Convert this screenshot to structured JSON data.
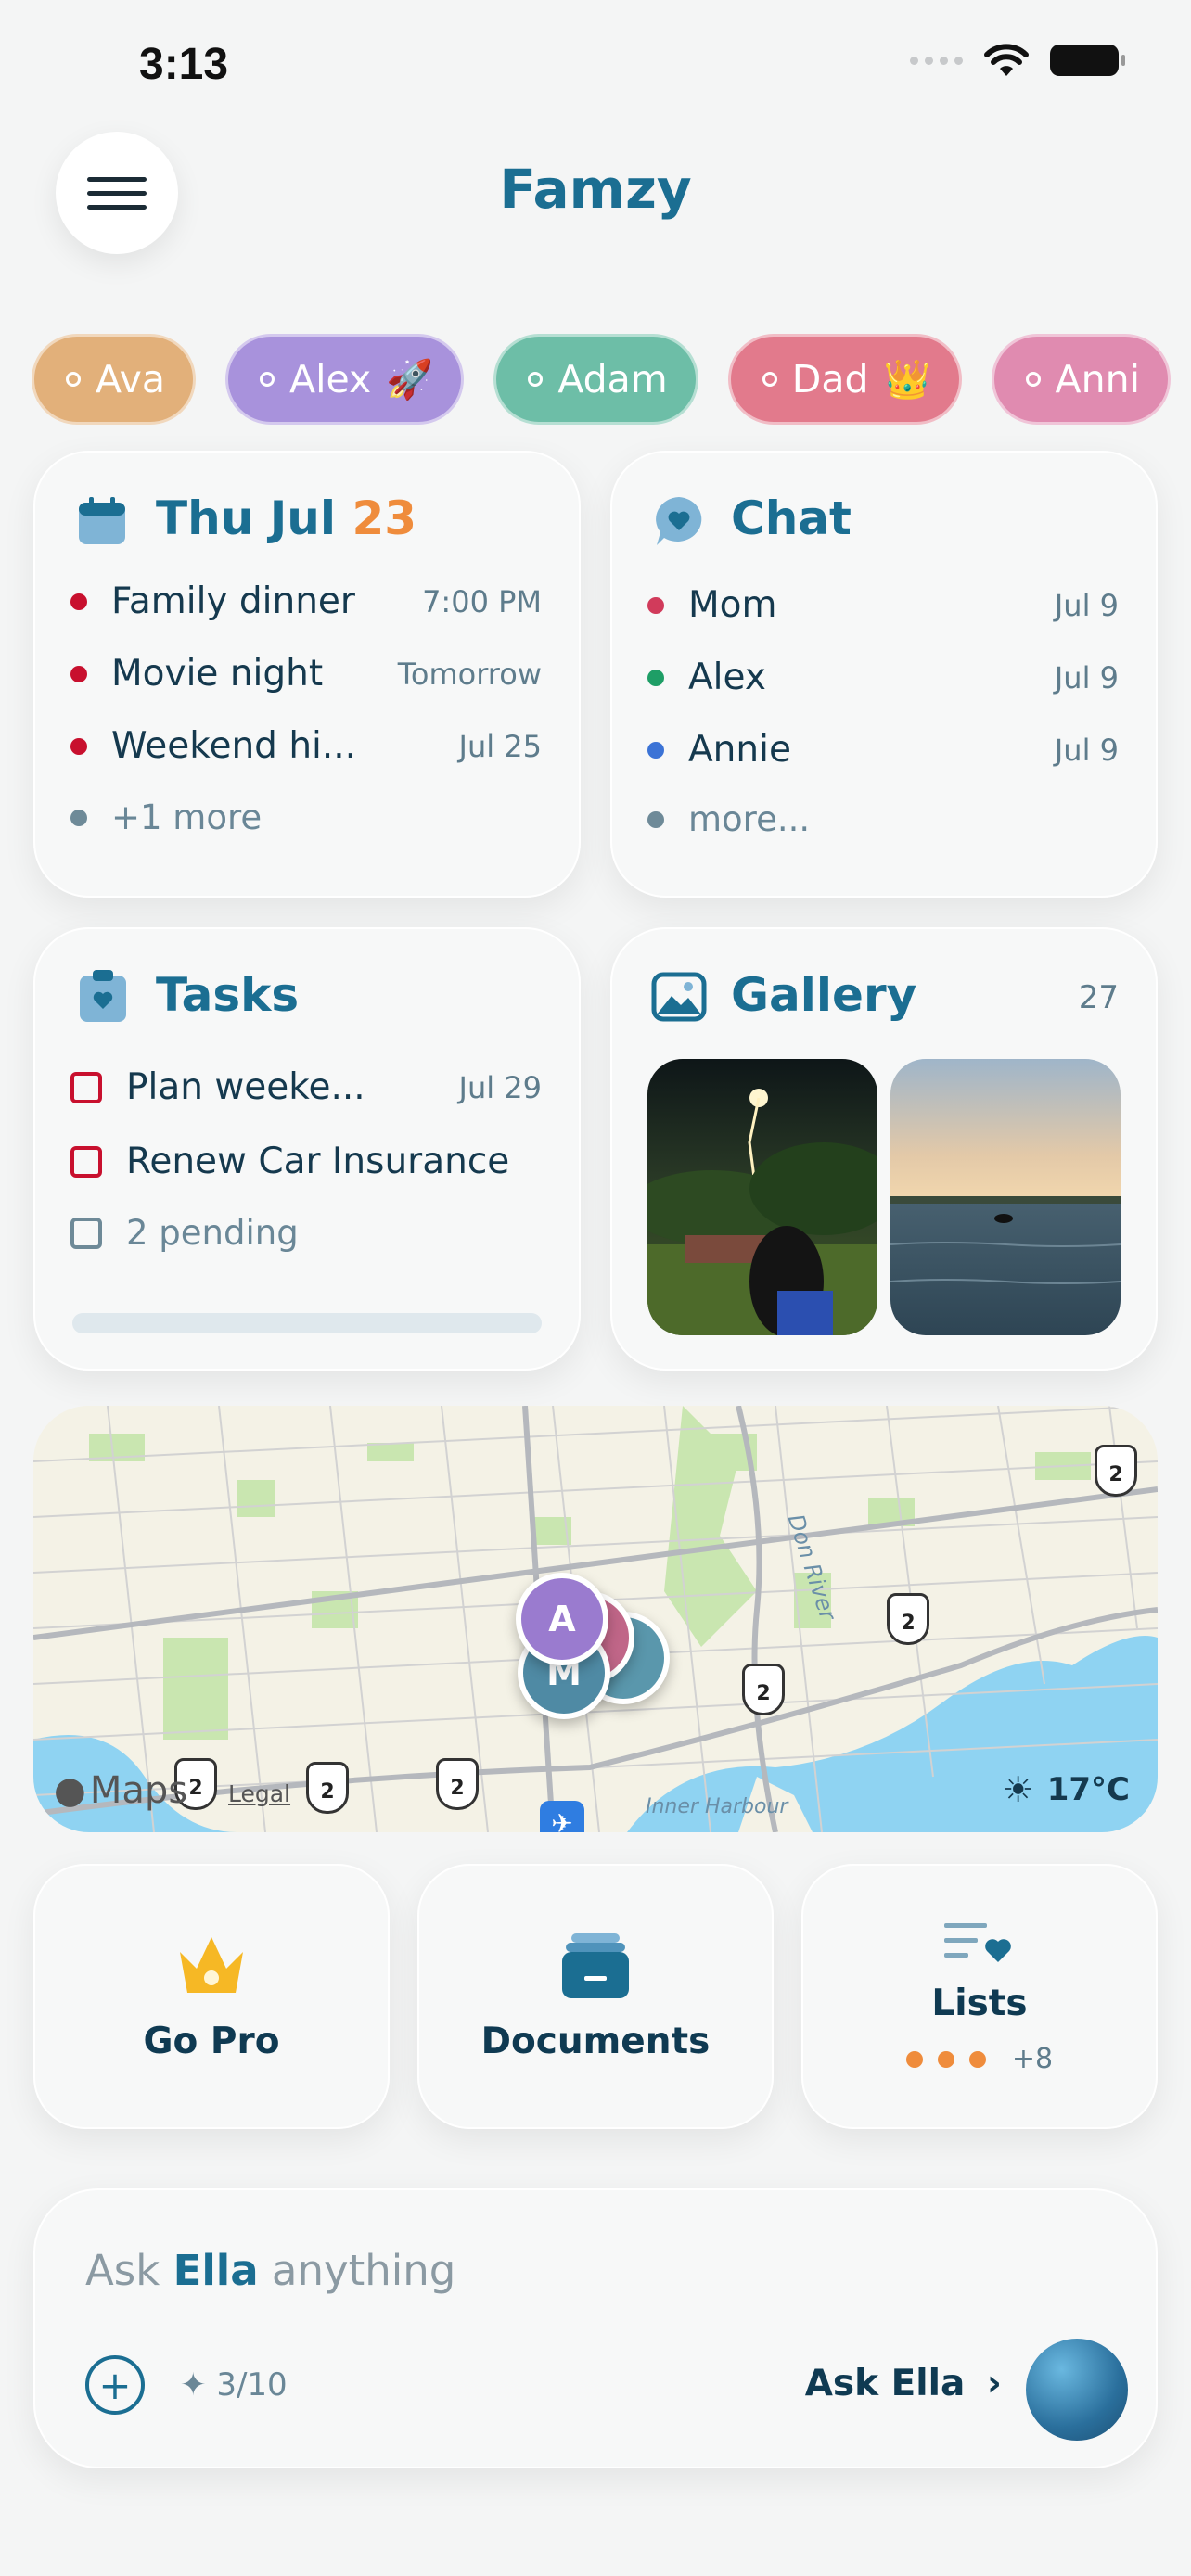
{
  "status_bar": {
    "time": "3:13"
  },
  "header": {
    "title": "Famzy"
  },
  "members": [
    {
      "name": "Ava",
      "emoji": "",
      "color": "#e2b07a"
    },
    {
      "name": "Alex",
      "emoji": "🚀",
      "color": "#a892dc"
    },
    {
      "name": "Adam",
      "emoji": "",
      "color": "#6dbea7"
    },
    {
      "name": "Dad",
      "emoji": "👑",
      "color": "#e27a8c"
    },
    {
      "name": "Anni",
      "emoji": "",
      "color": "#e08bb0"
    }
  ],
  "calendar": {
    "title_prefix": "Thu Jul",
    "day": "23",
    "events": [
      {
        "title": "Family dinner",
        "meta": "7:00 PM"
      },
      {
        "title": "Movie night",
        "meta": "Tomorrow"
      },
      {
        "title": "Weekend hi...",
        "meta": "Jul 25"
      }
    ],
    "more": "+1 more"
  },
  "chat": {
    "title": "Chat",
    "threads": [
      {
        "name": "Mom",
        "date": "Jul 9",
        "color": "#d13b5b"
      },
      {
        "name": "Alex",
        "date": "Jul 9",
        "color": "#1e9e66"
      },
      {
        "name": "Annie",
        "date": "Jul 9",
        "color": "#3b73d6"
      }
    ],
    "more": "more..."
  },
  "tasks": {
    "title": "Tasks",
    "items": [
      {
        "title": "Plan weeke...",
        "due": "Jul 29"
      },
      {
        "title": "Renew Car Insurance",
        "due": ""
      }
    ],
    "pending": "2 pending"
  },
  "gallery": {
    "title": "Gallery",
    "count": "27"
  },
  "map": {
    "attribution": "Maps",
    "legal": "Legal",
    "weather": "17°C",
    "labels": {
      "river": "Don River",
      "harbour": "Inner Harbour"
    },
    "pins": [
      "A",
      "A",
      "M"
    ]
  },
  "actions": {
    "go_pro": "Go Pro",
    "documents": "Documents",
    "lists": "Lists",
    "lists_more": "+8"
  },
  "assistant": {
    "prompt_prefix": "Ask",
    "name": "Ella",
    "prompt_suffix": "anything",
    "usage": "3/10",
    "ask_button": "Ask Ella"
  }
}
